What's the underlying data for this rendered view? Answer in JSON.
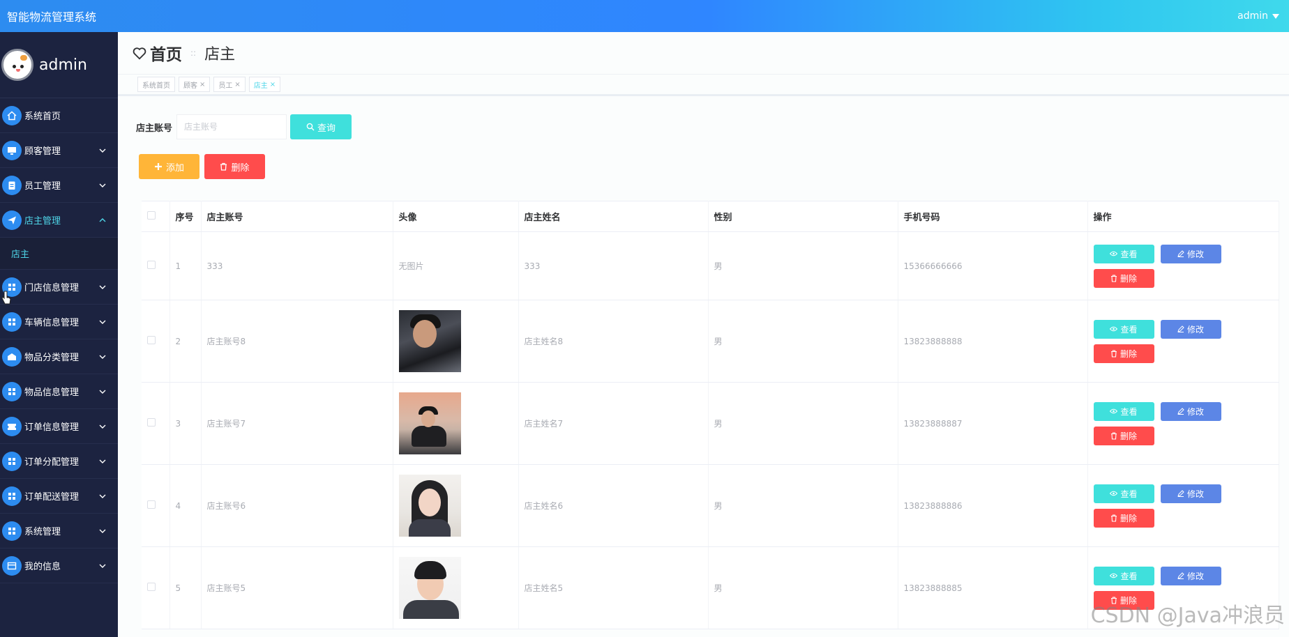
{
  "app": {
    "title": "智能物流管理系统",
    "user": "admin"
  },
  "sidebar": {
    "profile_name": "admin",
    "items": [
      {
        "label": "系统首页",
        "icon": "home-icon"
      },
      {
        "label": "顾客管理",
        "icon": "monitor-icon"
      },
      {
        "label": "员工管理",
        "icon": "clipboard-icon"
      },
      {
        "label": "店主管理",
        "icon": "send-icon"
      },
      {
        "label": "门店信息管理",
        "icon": "grid-icon"
      },
      {
        "label": "车辆信息管理",
        "icon": "grid-icon"
      },
      {
        "label": "物品分类管理",
        "icon": "box-icon"
      },
      {
        "label": "物品信息管理",
        "icon": "grid-icon"
      },
      {
        "label": "订单信息管理",
        "icon": "ticket-icon"
      },
      {
        "label": "订单分配管理",
        "icon": "grid-icon"
      },
      {
        "label": "订单配送管理",
        "icon": "grid-icon"
      },
      {
        "label": "系统管理",
        "icon": "grid-icon"
      },
      {
        "label": "我的信息",
        "icon": "card-icon"
      }
    ],
    "submenu": {
      "label": "店主"
    }
  },
  "breadcrumb": {
    "home": "首页",
    "separator": "::",
    "current": "店主"
  },
  "tags": [
    {
      "label": "系统首页"
    },
    {
      "label": "顾客",
      "close": "×"
    },
    {
      "label": "员工",
      "close": "×"
    },
    {
      "label": "店主",
      "close": "×"
    }
  ],
  "search": {
    "label": "店主账号",
    "placeholder": "店主账号",
    "button": "查询"
  },
  "actions": {
    "add": "添加",
    "delete": "删除"
  },
  "table": {
    "headers": [
      "序号",
      "店主账号",
      "头像",
      "店主姓名",
      "性别",
      "手机号码",
      "操作"
    ],
    "rows": [
      {
        "index": "1",
        "account": "333",
        "avatar": "无图片",
        "name": "333",
        "gender": "男",
        "phone": "15366666666"
      },
      {
        "index": "2",
        "account": "店主账号8",
        "avatar": "",
        "name": "店主姓名8",
        "gender": "男",
        "phone": "13823888888"
      },
      {
        "index": "3",
        "account": "店主账号7",
        "avatar": "",
        "name": "店主姓名7",
        "gender": "男",
        "phone": "13823888887"
      },
      {
        "index": "4",
        "account": "店主账号6",
        "avatar": "",
        "name": "店主姓名6",
        "gender": "男",
        "phone": "13823888886"
      },
      {
        "index": "5",
        "account": "店主账号5",
        "avatar": "",
        "name": "店主姓名5",
        "gender": "男",
        "phone": "13823888885"
      }
    ],
    "ops": {
      "view": "查看",
      "edit": "修改",
      "delete": "删除"
    }
  },
  "watermark": "CSDN @Java冲浪员",
  "colors": {
    "primary": "#2d8cf0",
    "accent": "#3fe0dc",
    "danger": "#ff4c4c",
    "warning": "#ffb538",
    "edit": "#5c86e6",
    "sidebar": "#1c2340"
  }
}
